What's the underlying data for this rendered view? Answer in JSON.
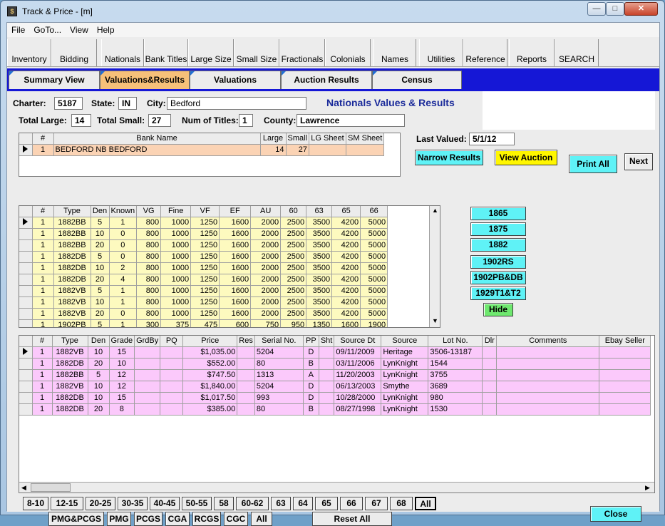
{
  "window": {
    "title": "Track & Price - [m]",
    "app_icon": "$"
  },
  "menubar": [
    "File",
    "GoTo...",
    "View",
    "Help"
  ],
  "toolbar": [
    "Inventory",
    "Bidding",
    "Nationals",
    "Bank Titles",
    "Large Size",
    "Small Size",
    "Fractionals",
    "Colonials",
    "Names",
    "Utilities",
    "Reference",
    "Reports",
    "SEARCH"
  ],
  "tabs": [
    "Summary View",
    "Valuations&Results",
    "Valuations",
    "Auction Results",
    "Census"
  ],
  "header": {
    "charter_label": "Charter:",
    "charter": "5187",
    "state_label": "State:",
    "state": "IN",
    "city_label": "City:",
    "city": "Bedford",
    "title": "Nationals Values & Results",
    "total_large_label": "Total Large:",
    "total_large": "14",
    "total_small_label": "Total Small:",
    "total_small": "27",
    "num_titles_label": "Num of Titles:",
    "num_titles": "1",
    "county_label": "County:",
    "county": "Lawrence",
    "last_valued_label": "Last Valued:",
    "last_valued": "5/1/12"
  },
  "bank_grid": {
    "columns": [
      "#",
      "Bank Name",
      "Large",
      "Small",
      "LG Sheet",
      "SM Sheet"
    ],
    "rows": [
      [
        "1",
        "BEDFORD NB BEDFORD",
        "14",
        "27",
        "",
        ""
      ]
    ]
  },
  "buttons": {
    "narrow": "Narrow Results",
    "view_auction": "View Auction",
    "print_all": "Print All",
    "next": "Next",
    "close": "Close",
    "reset_all": "Reset All"
  },
  "series_buttons": [
    "1865",
    "1875",
    "1882",
    "1902RS",
    "1902PB&DB",
    "1929T1&T2"
  ],
  "hide_button": "Hide",
  "values_grid": {
    "columns": [
      "#",
      "Type",
      "Den",
      "Known",
      "VG",
      "Fine",
      "VF",
      "EF",
      "AU",
      "60",
      "63",
      "65",
      "66"
    ],
    "rows": [
      [
        "1",
        "1882BB",
        "5",
        "1",
        "800",
        "1000",
        "1250",
        "1600",
        "2000",
        "2500",
        "3500",
        "4200",
        "5000"
      ],
      [
        "1",
        "1882BB",
        "10",
        "0",
        "800",
        "1000",
        "1250",
        "1600",
        "2000",
        "2500",
        "3500",
        "4200",
        "5000"
      ],
      [
        "1",
        "1882BB",
        "20",
        "0",
        "800",
        "1000",
        "1250",
        "1600",
        "2000",
        "2500",
        "3500",
        "4200",
        "5000"
      ],
      [
        "1",
        "1882DB",
        "5",
        "0",
        "800",
        "1000",
        "1250",
        "1600",
        "2000",
        "2500",
        "3500",
        "4200",
        "5000"
      ],
      [
        "1",
        "1882DB",
        "10",
        "2",
        "800",
        "1000",
        "1250",
        "1600",
        "2000",
        "2500",
        "3500",
        "4200",
        "5000"
      ],
      [
        "1",
        "1882DB",
        "20",
        "4",
        "800",
        "1000",
        "1250",
        "1600",
        "2000",
        "2500",
        "3500",
        "4200",
        "5000"
      ],
      [
        "1",
        "1882VB",
        "5",
        "1",
        "800",
        "1000",
        "1250",
        "1600",
        "2000",
        "2500",
        "3500",
        "4200",
        "5000"
      ],
      [
        "1",
        "1882VB",
        "10",
        "1",
        "800",
        "1000",
        "1250",
        "1600",
        "2000",
        "2500",
        "3500",
        "4200",
        "5000"
      ],
      [
        "1",
        "1882VB",
        "20",
        "0",
        "800",
        "1000",
        "1250",
        "1600",
        "2000",
        "2500",
        "3500",
        "4200",
        "5000"
      ],
      [
        "1",
        "1902PB",
        "5",
        "1",
        "300",
        "375",
        "475",
        "600",
        "750",
        "950",
        "1350",
        "1600",
        "1900"
      ]
    ]
  },
  "results_grid": {
    "columns": [
      "#",
      "Type",
      "Den",
      "Grade",
      "GrdBy",
      "PQ",
      "Price",
      "Res",
      "Serial No.",
      "PP",
      "Sht",
      "Source Dt",
      "Source",
      "Lot No.",
      "Dlr",
      "Comments",
      "Ebay Seller"
    ],
    "rows": [
      [
        "1",
        "1882VB",
        "10",
        "15",
        "",
        "",
        "$1,035.00",
        "",
        "5204",
        "D",
        "",
        "09/11/2009",
        "Heritage",
        "3506-13187",
        "",
        "",
        ""
      ],
      [
        "1",
        "1882DB",
        "20",
        "10",
        "",
        "",
        "$552.00",
        "",
        "80",
        "B",
        "",
        "03/11/2006",
        "LynKnight",
        "1544",
        "",
        "",
        ""
      ],
      [
        "1",
        "1882BB",
        "5",
        "12",
        "",
        "",
        "$747.50",
        "",
        "1313",
        "A",
        "",
        "11/20/2003",
        "LynKnight",
        "3755",
        "",
        "",
        ""
      ],
      [
        "1",
        "1882VB",
        "10",
        "12",
        "",
        "",
        "$1,840.00",
        "",
        "5204",
        "D",
        "",
        "06/13/2003",
        "Smythe",
        "3689",
        "",
        "",
        ""
      ],
      [
        "1",
        "1882DB",
        "10",
        "15",
        "",
        "",
        "$1,017.50",
        "",
        "993",
        "D",
        "",
        "10/28/2000",
        "LynKnight",
        "980",
        "",
        "",
        ""
      ],
      [
        "1",
        "1882DB",
        "20",
        "8",
        "",
        "",
        "$385.00",
        "",
        "80",
        "B",
        "",
        "08/27/1998",
        "LynKnight",
        "1530",
        "",
        "",
        ""
      ]
    ]
  },
  "grade_buttons": [
    "8-10",
    "12-15",
    "20-25",
    "30-35",
    "40-45",
    "50-55",
    "58",
    "60-62",
    "63",
    "64",
    "65",
    "66",
    "67",
    "68",
    "All"
  ],
  "grader_buttons": [
    "PMG&PCGS",
    "PMG",
    "PCGS",
    "CGA",
    "RCGS",
    "CGC",
    "All"
  ]
}
